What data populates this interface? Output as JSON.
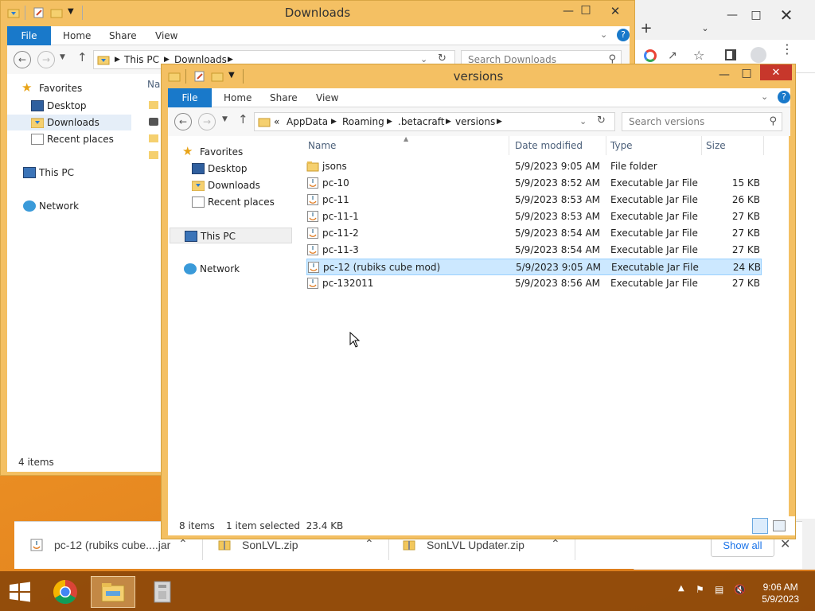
{
  "chrome": {
    "downloads": [
      {
        "name": "pc-12 (rubiks cube....jar"
      },
      {
        "name": "SonLVL.zip"
      },
      {
        "name": "SonLVL Updater.zip"
      }
    ],
    "show_all": "Show all"
  },
  "downloads_window": {
    "title": "Downloads",
    "tabs": {
      "file": "File",
      "home": "Home",
      "share": "Share",
      "view": "View"
    },
    "address": {
      "crumbs": [
        "This PC",
        "Downloads"
      ]
    },
    "search_placeholder": "Search Downloads",
    "nav": {
      "favorites": "Favorites",
      "desktop": "Desktop",
      "downloads": "Downloads",
      "recent": "Recent places",
      "this_pc": "This PC",
      "network": "Network"
    },
    "col_name_partial": "Nar",
    "status": "4 items"
  },
  "versions_window": {
    "title": "versions",
    "tabs": {
      "file": "File",
      "home": "Home",
      "share": "Share",
      "view": "View"
    },
    "address": {
      "prefix": "«",
      "crumbs": [
        "AppData",
        "Roaming",
        ".betacraft",
        "versions"
      ]
    },
    "search_placeholder": "Search versions",
    "nav": {
      "favorites": "Favorites",
      "desktop": "Desktop",
      "downloads": "Downloads",
      "recent": "Recent places",
      "this_pc": "This PC",
      "network": "Network"
    },
    "columns": {
      "name": "Name",
      "date": "Date modified",
      "type": "Type",
      "size": "Size"
    },
    "files": [
      {
        "name": "jsons",
        "date": "5/9/2023 9:05 AM",
        "type": "File folder",
        "size": "",
        "icon": "folder-icon"
      },
      {
        "name": "pc-10",
        "date": "5/9/2023 8:52 AM",
        "type": "Executable Jar File",
        "size": "15 KB",
        "icon": "jar-file-icon"
      },
      {
        "name": "pc-11",
        "date": "5/9/2023 8:53 AM",
        "type": "Executable Jar File",
        "size": "26 KB",
        "icon": "jar-file-icon"
      },
      {
        "name": "pc-11-1",
        "date": "5/9/2023 8:53 AM",
        "type": "Executable Jar File",
        "size": "27 KB",
        "icon": "jar-file-icon"
      },
      {
        "name": "pc-11-2",
        "date": "5/9/2023 8:54 AM",
        "type": "Executable Jar File",
        "size": "27 KB",
        "icon": "jar-file-icon"
      },
      {
        "name": "pc-11-3",
        "date": "5/9/2023 8:54 AM",
        "type": "Executable Jar File",
        "size": "27 KB",
        "icon": "jar-file-icon"
      },
      {
        "name": "pc-12 (rubiks cube mod)",
        "date": "5/9/2023 9:05 AM",
        "type": "Executable Jar File",
        "size": "24 KB",
        "icon": "jar-file-icon",
        "selected": true
      },
      {
        "name": "pc-132011",
        "date": "5/9/2023 8:56 AM",
        "type": "Executable Jar File",
        "size": "27 KB",
        "icon": "jar-file-icon"
      }
    ],
    "status": {
      "count": "8 items",
      "selection": "1 item selected  23.4 KB"
    }
  },
  "taskbar": {
    "clock_time": "9:06 AM",
    "clock_date": "5/9/2023"
  },
  "colors": {
    "accent": "#1979ca",
    "explorer_frame": "#f4c063",
    "selection": "#cce8ff",
    "taskbar": "#8c480a"
  }
}
